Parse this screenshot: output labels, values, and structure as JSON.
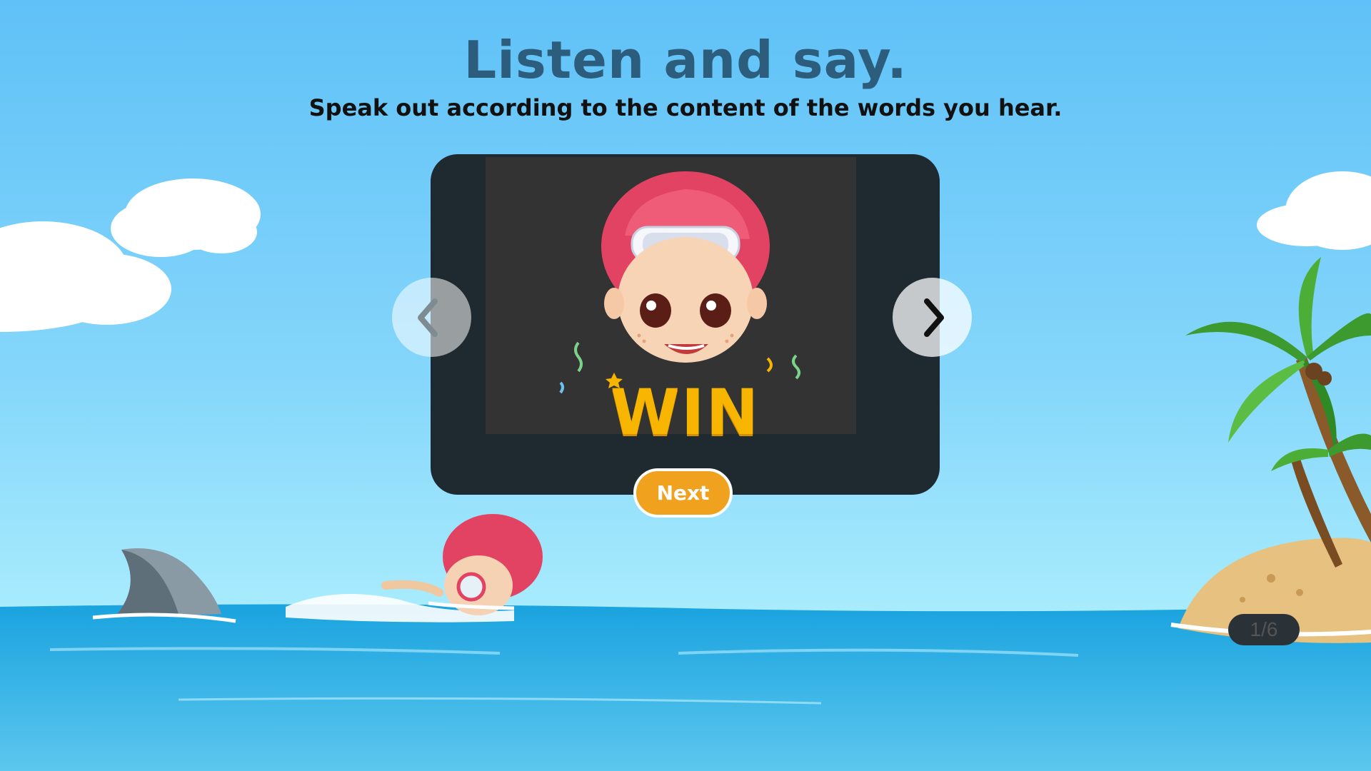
{
  "header": {
    "title": "Listen and say.",
    "subtitle": "Speak out according to the content of the words you hear."
  },
  "card": {
    "word": "WIN",
    "counter": "1/6",
    "illustration": "boy-with-swim-cap"
  },
  "nav": {
    "prev_icon": "chevron-left-icon",
    "next_icon": "chevron-right-icon"
  },
  "actions": {
    "next_label": "Next"
  },
  "colors": {
    "title": "#2c5d7c",
    "card_bg": "#1e2a30",
    "accent": "#f0a21e",
    "word": "#f7b500"
  }
}
